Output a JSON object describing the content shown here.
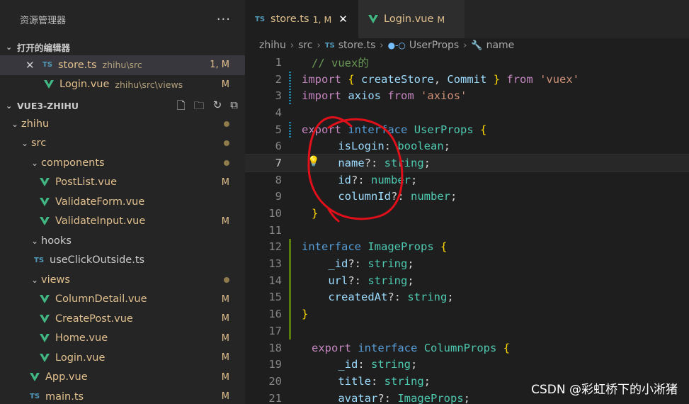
{
  "explorer": {
    "title": "资源管理器",
    "more": "···",
    "open_editors_label": "打开的编辑器",
    "open_editors": [
      {
        "name": "store.ts",
        "path": "zhihu\\src",
        "status": "1, M",
        "icon": "ts-icon"
      },
      {
        "name": "Login.vue",
        "path": "zhihu\\src\\views",
        "status": "M",
        "icon": "vue-icon"
      }
    ],
    "project_label": "VUE3-ZHIHU",
    "tree": [
      {
        "name": "zhihu",
        "type": "folder",
        "status": "dot"
      },
      {
        "name": "src",
        "type": "folder",
        "status": "dot"
      },
      {
        "name": "components",
        "type": "folder",
        "status": "dot"
      },
      {
        "name": "PostList.vue",
        "type": "vue",
        "status": "M"
      },
      {
        "name": "ValidateForm.vue",
        "type": "vue",
        "status": ""
      },
      {
        "name": "ValidateInput.vue",
        "type": "vue",
        "status": "M"
      },
      {
        "name": "hooks",
        "type": "folder",
        "status": ""
      },
      {
        "name": "useClickOutside.ts",
        "type": "ts",
        "status": ""
      },
      {
        "name": "views",
        "type": "folder",
        "status": "dot"
      },
      {
        "name": "ColumnDetail.vue",
        "type": "vue",
        "status": "M"
      },
      {
        "name": "CreatePost.vue",
        "type": "vue",
        "status": "M"
      },
      {
        "name": "Home.vue",
        "type": "vue",
        "status": "M"
      },
      {
        "name": "Login.vue",
        "type": "vue",
        "status": "M"
      },
      {
        "name": "App.vue",
        "type": "vue",
        "status": "M"
      },
      {
        "name": "main.ts",
        "type": "ts",
        "status": "M"
      }
    ]
  },
  "tabs": [
    {
      "icon_text": "TS",
      "name": "store.ts",
      "status": "1, M",
      "close": "✕"
    },
    {
      "icon_text": "",
      "name": "Login.vue",
      "status": "M",
      "close": ""
    }
  ],
  "breadcrumb": {
    "items": [
      "zhihu",
      "src",
      "store.ts",
      "UserProps",
      "name"
    ],
    "ts_icon": "TS"
  },
  "code_lines": [
    {
      "n": "1",
      "gutter": "",
      "tokens": [
        [
          "cm",
          "// vuex的"
        ]
      ]
    },
    {
      "n": "2",
      "gutter": "mod",
      "tokens": [
        [
          "kw",
          "import"
        ],
        [
          "",
          " "
        ],
        [
          "br",
          "{"
        ],
        [
          "",
          " "
        ],
        [
          "id",
          "createStore"
        ],
        [
          "",
          ", "
        ],
        [
          "id",
          "Commit"
        ],
        [
          "",
          " "
        ],
        [
          "br",
          "}"
        ],
        [
          "",
          " "
        ],
        [
          "kw",
          "from"
        ],
        [
          "",
          " "
        ],
        [
          "str",
          "'vuex'"
        ]
      ]
    },
    {
      "n": "3",
      "gutter": "mod",
      "tokens": [
        [
          "kw",
          "import"
        ],
        [
          "",
          " "
        ],
        [
          "id",
          "axios"
        ],
        [
          "",
          " "
        ],
        [
          "kw",
          "from"
        ],
        [
          "",
          " "
        ],
        [
          "str",
          "'axios'"
        ]
      ]
    },
    {
      "n": "4",
      "gutter": "",
      "tokens": []
    },
    {
      "n": "5",
      "gutter": "mod",
      "tokens": [
        [
          "kw",
          "export"
        ],
        [
          "",
          " "
        ],
        [
          "kw2",
          "interface"
        ],
        [
          "",
          " "
        ],
        [
          "ty",
          "UserProps"
        ],
        [
          "",
          " "
        ],
        [
          "br",
          "{"
        ]
      ]
    },
    {
      "n": "6",
      "gutter": "",
      "tokens": [
        [
          "",
          "    "
        ],
        [
          "id",
          "isLogin"
        ],
        [
          "",
          ": "
        ],
        [
          "ty",
          "boolean"
        ],
        [
          "",
          ";"
        ]
      ]
    },
    {
      "n": "7",
      "gutter": "",
      "tokens": [
        [
          "",
          "    "
        ],
        [
          "id",
          "name"
        ],
        [
          "",
          "?: "
        ],
        [
          "ty",
          "string"
        ],
        [
          "",
          ";"
        ]
      ]
    },
    {
      "n": "8",
      "gutter": "",
      "tokens": [
        [
          "",
          "    "
        ],
        [
          "id",
          "id"
        ],
        [
          "",
          "?: "
        ],
        [
          "ty",
          "number"
        ],
        [
          "",
          ";"
        ]
      ]
    },
    {
      "n": "9",
      "gutter": "",
      "tokens": [
        [
          "",
          "    "
        ],
        [
          "id",
          "columnId"
        ],
        [
          "",
          "?: "
        ],
        [
          "ty",
          "number"
        ],
        [
          "",
          ";"
        ]
      ]
    },
    {
      "n": "10",
      "gutter": "",
      "tokens": [
        [
          "br",
          "}"
        ]
      ]
    },
    {
      "n": "11",
      "gutter": "",
      "tokens": []
    },
    {
      "n": "12",
      "gutter": "add",
      "tokens": [
        [
          "kw2",
          "interface"
        ],
        [
          "",
          " "
        ],
        [
          "ty",
          "ImageProps"
        ],
        [
          "",
          " "
        ],
        [
          "br",
          "{"
        ]
      ]
    },
    {
      "n": "13",
      "gutter": "add",
      "tokens": [
        [
          "",
          "    "
        ],
        [
          "id",
          "_id"
        ],
        [
          "",
          "?: "
        ],
        [
          "ty",
          "string"
        ],
        [
          "",
          ";"
        ]
      ]
    },
    {
      "n": "14",
      "gutter": "add",
      "tokens": [
        [
          "",
          "    "
        ],
        [
          "id",
          "url"
        ],
        [
          "",
          "?: "
        ],
        [
          "ty",
          "string"
        ],
        [
          "",
          ";"
        ]
      ]
    },
    {
      "n": "15",
      "gutter": "add",
      "tokens": [
        [
          "",
          "    "
        ],
        [
          "id",
          "createdAt"
        ],
        [
          "",
          "?: "
        ],
        [
          "ty",
          "string"
        ],
        [
          "",
          ";"
        ]
      ]
    },
    {
      "n": "16",
      "gutter": "add",
      "tokens": [
        [
          "br",
          "}"
        ]
      ]
    },
    {
      "n": "17",
      "gutter": "add",
      "tokens": []
    },
    {
      "n": "18",
      "gutter": "",
      "tokens": [
        [
          "kw",
          "export"
        ],
        [
          "",
          " "
        ],
        [
          "kw2",
          "interface"
        ],
        [
          "",
          " "
        ],
        [
          "ty",
          "ColumnProps"
        ],
        [
          "",
          " "
        ],
        [
          "br",
          "{"
        ]
      ]
    },
    {
      "n": "19",
      "gutter": "",
      "tokens": [
        [
          "",
          "    "
        ],
        [
          "id",
          "_id"
        ],
        [
          "",
          ": "
        ],
        [
          "ty",
          "string"
        ],
        [
          "",
          ";"
        ]
      ]
    },
    {
      "n": "20",
      "gutter": "",
      "tokens": [
        [
          "",
          "    "
        ],
        [
          "id",
          "title"
        ],
        [
          "",
          ": "
        ],
        [
          "ty",
          "string"
        ],
        [
          "",
          ";"
        ]
      ]
    },
    {
      "n": "21",
      "gutter": "",
      "tokens": [
        [
          "",
          "    "
        ],
        [
          "id",
          "avatar"
        ],
        [
          "",
          "?: "
        ],
        [
          "ty",
          "ImageProps"
        ],
        [
          "",
          ";"
        ]
      ]
    }
  ],
  "current_line": "7",
  "watermark": "CSDN @彩虹桥下的小淅猪",
  "colors": {
    "annotation": "#e0101a",
    "modified": "#e2c08d",
    "ts": "#519aba",
    "vue": "#41b883"
  }
}
